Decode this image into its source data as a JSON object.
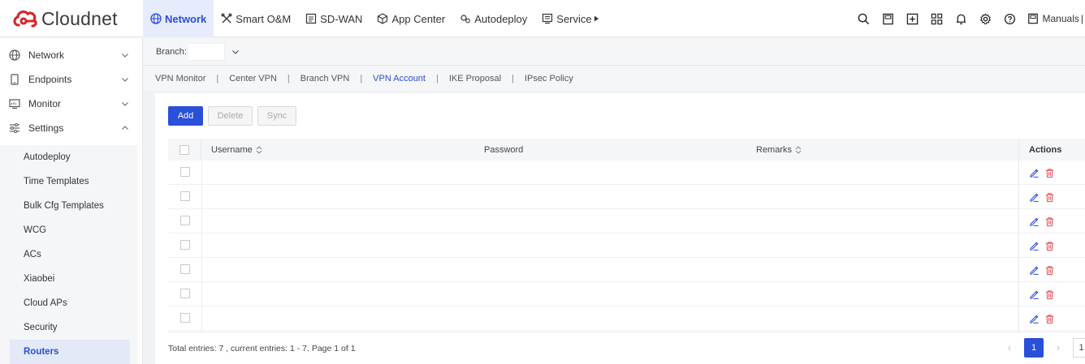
{
  "app": {
    "logo_text": "Cloudnet"
  },
  "nav": [
    {
      "label": "Network",
      "icon": "globe-icon"
    },
    {
      "label": "Smart O&M",
      "icon": "tools-icon"
    },
    {
      "label": "SD-WAN",
      "icon": "sdwan-icon"
    },
    {
      "label": "App Center",
      "icon": "cube-icon"
    },
    {
      "label": "Autodeploy",
      "icon": "gears-icon"
    },
    {
      "label": "Service",
      "icon": "service-icon"
    }
  ],
  "topbar": {
    "manuals_label": "Manuals"
  },
  "sidebar": {
    "items": [
      {
        "label": "Network"
      },
      {
        "label": "Endpoints"
      },
      {
        "label": "Monitor"
      },
      {
        "label": "Settings"
      }
    ],
    "settings_sub": [
      "Autodeploy",
      "Time Templates",
      "Bulk Cfg Templates",
      "WCG",
      "ACs",
      "Xiaobei",
      "Cloud APs",
      "Security",
      "Routers"
    ]
  },
  "branch": {
    "label": "Branch:",
    "value": ""
  },
  "subtabs": [
    "VPN Monitor",
    "Center VPN",
    "Branch VPN",
    "VPN Account",
    "IKE Proposal",
    "IPsec Policy"
  ],
  "toolbar": {
    "add": "Add",
    "delete": "Delete",
    "sync": "Sync"
  },
  "table": {
    "columns": {
      "username": "Username",
      "password": "Password",
      "remarks": "Remarks",
      "actions": "Actions"
    },
    "rows": [
      {
        "username": "",
        "password": "",
        "remarks": ""
      },
      {
        "username": "",
        "password": "",
        "remarks": ""
      },
      {
        "username": "",
        "password": "",
        "remarks": ""
      },
      {
        "username": "",
        "password": "",
        "remarks": ""
      },
      {
        "username": "",
        "password": "",
        "remarks": ""
      },
      {
        "username": "",
        "password": "",
        "remarks": ""
      },
      {
        "username": "",
        "password": "",
        "remarks": ""
      }
    ]
  },
  "footer": {
    "total_text": "Total entries: 7 , current entries: 1 - 7. Page 1 of 1"
  },
  "pager": {
    "prev": "‹",
    "current_page": "1",
    "next": "›",
    "jump_value": "1"
  },
  "colors": {
    "accent": "#2a4fd8",
    "brand_red": "#d6262b",
    "delete_red": "#e0484e"
  }
}
